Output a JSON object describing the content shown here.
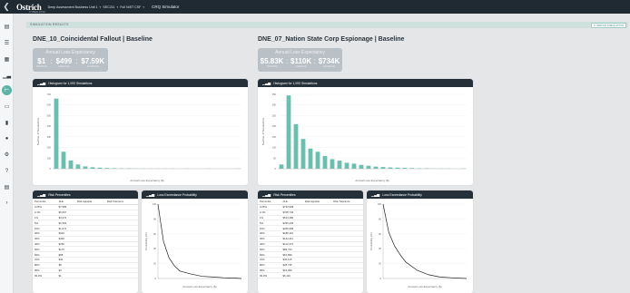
{
  "topbar": {
    "logo": "Ostrich",
    "logo_sub": "CYBER-RISK",
    "crumb1": "Deep Assessment Business Unit 1",
    "crumb2": "SEC211",
    "crumb3": "Full NIST CSF",
    "app_title": "CRQ Simulator"
  },
  "sidebar": {
    "icons": [
      "clipboard-icon",
      "list-icon",
      "calculator-icon",
      "bar-chart-icon",
      "simulator-icon",
      "folder-icon",
      "library-icon",
      "users-icon",
      "gear-icon",
      "help-icon",
      "document-icon",
      "chevron-right-icon"
    ]
  },
  "section": {
    "label": "SIMULATION RESULTS",
    "button": "RERUN SIMULATION"
  },
  "panels": [
    {
      "title": "DNE_10_Coincidental Fallout | Baseline",
      "ale": {
        "title": "Annual Loss Expectancy",
        "values": [
          {
            "value": "$1",
            "label": "MINIMUM"
          },
          {
            "value": "$499",
            "label": "AVERAGE"
          },
          {
            "value": "$7.59K",
            "label": "MAXIMUM"
          }
        ]
      },
      "histogram": {
        "title": "Histogram for 1,000 Simulations",
        "ylabel": "Number of Simulations",
        "xlabel": "Annual Loss Expectancy ($)"
      },
      "percentiles": {
        "title": "Risk Percentiles",
        "columns": [
          "Percentile",
          "ALE",
          "Risk Appetite",
          "Risk Tolerance"
        ],
        "rows": [
          [
            "0.05%",
            "$7,589"
          ],
          [
            "0.1%",
            "$6,697"
          ],
          [
            "1%",
            "$3,272"
          ],
          [
            "5%",
            "$1,594"
          ],
          [
            "10%",
            "$1,074"
          ],
          [
            "20%",
            "$620"
          ],
          [
            "30%",
            "$400"
          ],
          [
            "40%",
            "$266"
          ],
          [
            "50%",
            "$175"
          ],
          [
            "60%",
            "$88"
          ],
          [
            "70%",
            "$30"
          ],
          [
            "80%",
            "$8"
          ],
          [
            "90%",
            "$3"
          ],
          [
            "99.9%",
            "$1"
          ]
        ]
      },
      "exceedance": {
        "title": "Loss Exceedance Probability",
        "ylabel": "Probability (%)",
        "xlabel": "Annual Loss Expectancy ($)"
      }
    },
    {
      "title": "DNE_07_Nation State Corp Espionage | Baseline",
      "ale": {
        "title": "Annual Loss Expectancy",
        "values": [
          {
            "value": "$5.83K",
            "label": "MINIMUM"
          },
          {
            "value": "$110K",
            "label": "AVERAGE"
          },
          {
            "value": "$734K",
            "label": "MAXIMUM"
          }
        ]
      },
      "histogram": {
        "title": "Histogram for 1,000 Simulations",
        "ylabel": "Number of Simulations",
        "xlabel": "Annual Loss Expectancy ($)"
      },
      "percentiles": {
        "title": "Risk Percentiles",
        "columns": [
          "Percentile",
          "ALE",
          "Risk Appetite",
          "Risk Tolerance"
        ],
        "rows": [
          [
            "0.05%",
            "$733,998"
          ],
          [
            "0.1%",
            "$708,746"
          ],
          [
            "1%",
            "$514,480"
          ],
          [
            "5%",
            "$335,436"
          ],
          [
            "10%",
            "$266,089"
          ],
          [
            "20%",
            "$188,119"
          ],
          [
            "30%",
            "$144,411"
          ],
          [
            "40%",
            "$112,373"
          ],
          [
            "50%",
            "$86,723"
          ],
          [
            "60%",
            "$64,899"
          ],
          [
            "70%",
            "$45,115"
          ],
          [
            "80%",
            "$28,745"
          ],
          [
            "90%",
            "$15,009"
          ],
          [
            "99.9%",
            "$6,119"
          ]
        ]
      },
      "exceedance": {
        "title": "Loss Exceedance Probability",
        "ylabel": "Probability (%)",
        "xlabel": "Annual Loss Expectancy ($)"
      }
    }
  ],
  "chart_data": [
    {
      "type": "bar",
      "title": "Histogram for 1,000 Simulations",
      "xlabel": "Annual Loss Expectancy ($)",
      "ylabel": "Number of Simulations",
      "ylim": [
        0,
        700
      ],
      "values": [
        660,
        160,
        78,
        40,
        22,
        14,
        10,
        7,
        5,
        3,
        3,
        2,
        2,
        1,
        1,
        1,
        1,
        0,
        1,
        0,
        0,
        1,
        0,
        0,
        0,
        1
      ],
      "color": "#6cbfae"
    },
    {
      "type": "line",
      "title": "Loss Exceedance Probability",
      "xlabel": "Annual Loss Expectancy ($)",
      "ylabel": "Probability (%)",
      "ylim": [
        0,
        100
      ],
      "x": [
        0,
        500,
        1000,
        1500,
        2000,
        3000,
        4000,
        5000,
        6000,
        7000,
        7600
      ],
      "y": [
        100,
        50,
        28,
        17,
        10,
        6,
        3,
        2,
        1,
        0.5,
        0
      ]
    },
    {
      "type": "bar",
      "title": "Histogram for 1,000 Simulations",
      "xlabel": "Annual Loss Expectancy ($)",
      "ylabel": "Number of Simulations",
      "ylim": [
        0,
        350
      ],
      "values": [
        20,
        345,
        210,
        140,
        95,
        80,
        60,
        45,
        38,
        28,
        24,
        18,
        14,
        10,
        8,
        6,
        5,
        4,
        3,
        2,
        2,
        1,
        1,
        1,
        0,
        1
      ],
      "color": "#6cbfae"
    },
    {
      "type": "line",
      "title": "Loss Exceedance Probability",
      "xlabel": "Annual Loss Expectancy ($)",
      "ylabel": "Probability (%)",
      "ylim": [
        0,
        100
      ],
      "x": [
        0,
        50000,
        100000,
        150000,
        200000,
        300000,
        400000,
        500000,
        600000,
        734000
      ],
      "y": [
        100,
        62,
        44,
        32,
        22,
        11,
        5,
        2,
        1,
        0
      ]
    }
  ]
}
